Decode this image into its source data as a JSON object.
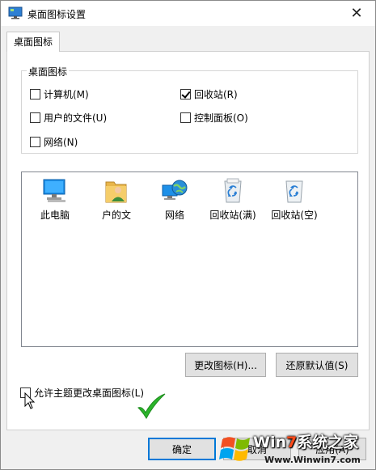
{
  "window": {
    "title": "桌面图标设置",
    "close_glyph": "✕"
  },
  "tabs": [
    {
      "label": "桌面图标",
      "active": true
    }
  ],
  "desktop_icons_group": {
    "label": "桌面图标",
    "items": [
      {
        "label": "计算机(M)",
        "checked": false
      },
      {
        "label": "回收站(R)",
        "checked": true
      },
      {
        "label": "用户的文件(U)",
        "checked": false
      },
      {
        "label": "控制面板(O)",
        "checked": false
      },
      {
        "label": "网络(N)",
        "checked": false
      }
    ]
  },
  "icon_list": [
    {
      "label": "此电脑",
      "icon": "computer-icon"
    },
    {
      "label": "户的文",
      "icon": "user-folder-icon"
    },
    {
      "label": "网络",
      "icon": "network-icon"
    },
    {
      "label": "回收站(满)",
      "icon": "recycle-bin-full-icon"
    },
    {
      "label": "回收站(空)",
      "icon": "recycle-bin-empty-icon"
    }
  ],
  "buttons": {
    "change_icon": "更改图标(H)...",
    "restore_default": "还原默认值(S)",
    "ok": "确定",
    "cancel": "取消",
    "apply": "应用(A)"
  },
  "allow_themes": {
    "label": "允许主题更改桌面图标(L)",
    "checked": false
  },
  "watermark": {
    "brand_prefix": "Win",
    "brand_seven": "7",
    "brand_suffix": "系统之家",
    "url": "Www.Winwin7.com"
  },
  "colors": {
    "accent": "#0078d7",
    "check_green": "#2bb52b",
    "watermark_seven": "#ff4a1a"
  }
}
